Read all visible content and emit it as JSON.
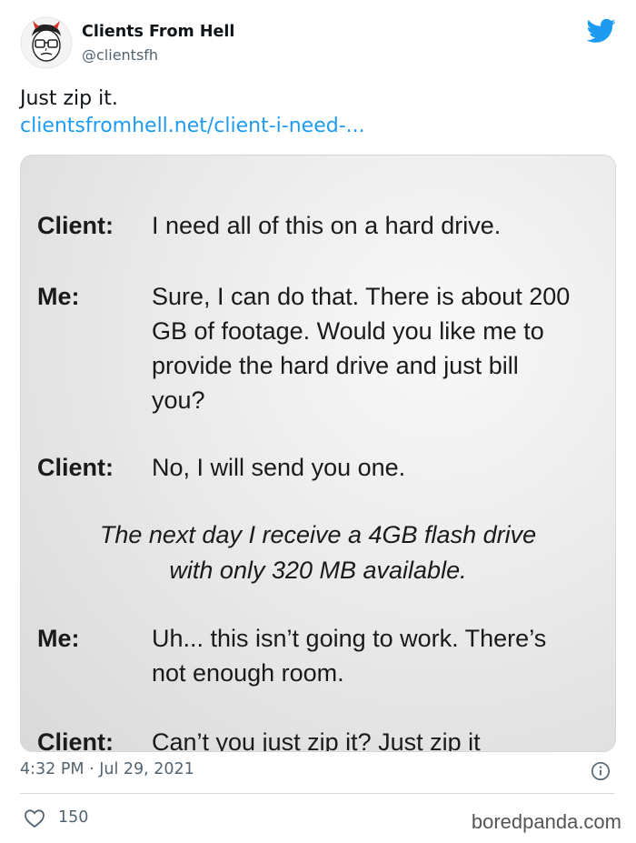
{
  "account": {
    "display_name": "Clients From Hell",
    "handle": "@clientsfh"
  },
  "tweet": {
    "text": "Just zip it.",
    "link": "clientsfromhell.net/client-i-need-..."
  },
  "media": {
    "conversation": [
      {
        "speaker": "Client:",
        "text": "I need all of this on a hard drive."
      },
      {
        "speaker": "Me:",
        "lines": [
          "Sure, I can do that. There is about 200",
          "GB of footage. Would you like me to",
          "provide the hard drive and just bill",
          "you?"
        ]
      },
      {
        "speaker": "Client:",
        "text": "No, I will send you one."
      },
      {
        "narration": [
          "The next day I receive a 4GB flash drive",
          "with only 320 MB available."
        ]
      },
      {
        "speaker": "Me:",
        "lines": [
          "Uh... this isn’t going to work. There’s",
          "not enough room."
        ]
      },
      {
        "speaker": "Client:",
        "text": "Can’t you just zip it? Just zip it"
      }
    ]
  },
  "meta": {
    "timestamp": "4:32 PM · Jul 29, 2021",
    "like_count": "150"
  },
  "watermark": "boredpanda.com",
  "colors": {
    "link": "#1d9bf0",
    "twitter_brand": "#1d9bf0",
    "muted_text": "#536471",
    "border": "#cfd9de"
  },
  "icons": [
    "avatar-illustration",
    "twitter-bird-icon",
    "info-icon",
    "heart-icon"
  ]
}
